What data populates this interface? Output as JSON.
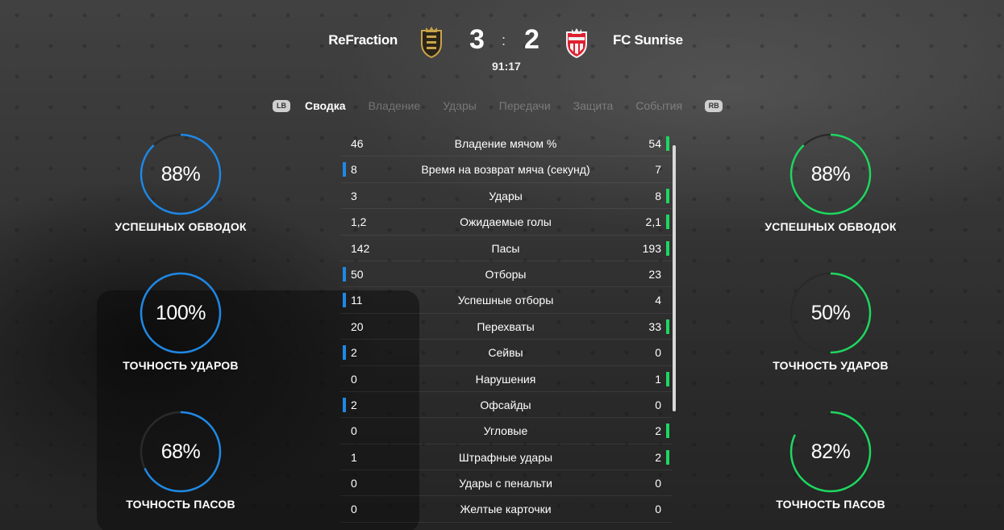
{
  "colors": {
    "home_accent": "#1e88e5",
    "away_accent": "#1ed760",
    "ring_track": "#2a2a2a"
  },
  "match": {
    "home_team": "ReFraction",
    "away_team": "FC Sunrise",
    "home_score": "3",
    "away_score": "2",
    "separator": ":",
    "clock": "91:17",
    "home_crest_icon": "club-crest-gold-icon",
    "away_crest_icon": "club-crest-red-white-icon"
  },
  "tabs": {
    "lb": "LB",
    "rb": "RB",
    "items": [
      {
        "label": "Сводка",
        "active": true
      },
      {
        "label": "Владение",
        "active": false
      },
      {
        "label": "Удары",
        "active": false
      },
      {
        "label": "Передачи",
        "active": false
      },
      {
        "label": "Защита",
        "active": false
      },
      {
        "label": "События",
        "active": false
      }
    ]
  },
  "home_rings": [
    {
      "value": "88%",
      "fraction": 0.88,
      "label": "УСПЕШНЫХ ОБВОДОК"
    },
    {
      "value": "100%",
      "fraction": 1.0,
      "label": "ТОЧНОСТЬ УДАРОВ"
    },
    {
      "value": "68%",
      "fraction": 0.68,
      "label": "ТОЧНОСТЬ ПАСОВ"
    }
  ],
  "away_rings": [
    {
      "value": "88%",
      "fraction": 0.88,
      "label": "УСПЕШНЫХ ОБВОДОК"
    },
    {
      "value": "50%",
      "fraction": 0.5,
      "label": "ТОЧНОСТЬ УДАРОВ"
    },
    {
      "value": "82%",
      "fraction": 0.82,
      "label": "ТОЧНОСТЬ ПАСОВ"
    }
  ],
  "stats": [
    {
      "label": "Владение мячом %",
      "home": "46",
      "away": "54",
      "leader": "away"
    },
    {
      "label": "Время на возврат мяча (секунд)",
      "home": "8",
      "away": "7",
      "leader": "home"
    },
    {
      "label": "Удары",
      "home": "3",
      "away": "8",
      "leader": "away"
    },
    {
      "label": "Ожидаемые голы",
      "home": "1,2",
      "away": "2,1",
      "leader": "away"
    },
    {
      "label": "Пасы",
      "home": "142",
      "away": "193",
      "leader": "away"
    },
    {
      "label": "Отборы",
      "home": "50",
      "away": "23",
      "leader": "home"
    },
    {
      "label": "Успешные отборы",
      "home": "11",
      "away": "4",
      "leader": "home"
    },
    {
      "label": "Перехваты",
      "home": "20",
      "away": "33",
      "leader": "away"
    },
    {
      "label": "Сейвы",
      "home": "2",
      "away": "0",
      "leader": "home"
    },
    {
      "label": "Нарушения",
      "home": "0",
      "away": "1",
      "leader": "away"
    },
    {
      "label": "Офсайды",
      "home": "2",
      "away": "0",
      "leader": "home"
    },
    {
      "label": "Угловые",
      "home": "0",
      "away": "2",
      "leader": "away"
    },
    {
      "label": "Штрафные удары",
      "home": "1",
      "away": "2",
      "leader": "away"
    },
    {
      "label": "Удары с пенальти",
      "home": "0",
      "away": "0",
      "leader": "none"
    },
    {
      "label": "Желтые карточки",
      "home": "0",
      "away": "0",
      "leader": "none"
    }
  ]
}
